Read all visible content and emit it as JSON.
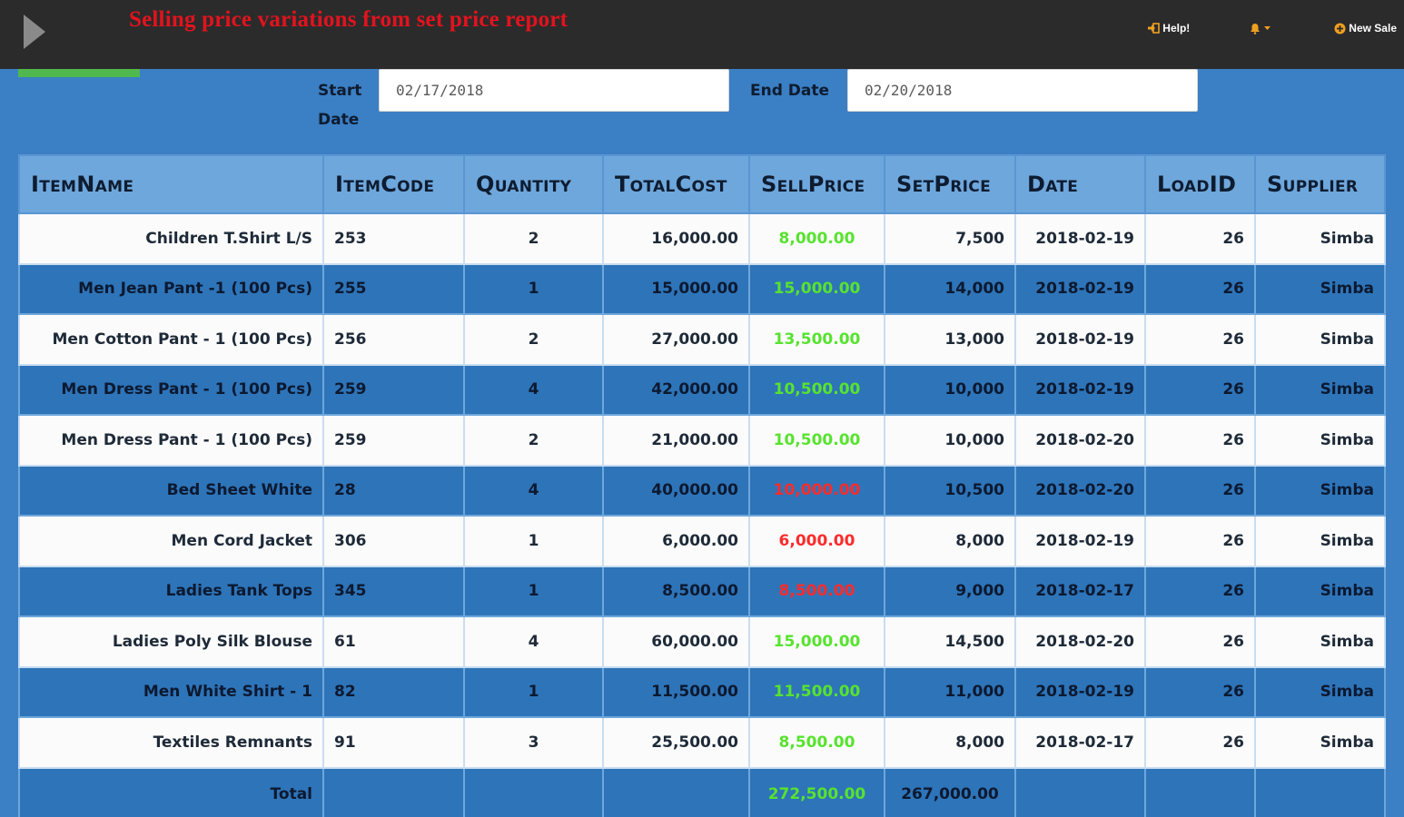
{
  "header": {
    "title": "Selling price variations from set price report",
    "help_label": "Help!",
    "new_sale_label": "New Sale"
  },
  "filters": {
    "start_label": "Start Date",
    "start_value": "02/17/2018",
    "end_label": "End Date",
    "end_value": "02/20/2018"
  },
  "table": {
    "columns": [
      "ItemName",
      "ItemCode",
      "Quantity",
      "TotalCost",
      "SellPrice",
      "SetPrice",
      "Date",
      "LoadID",
      "Supplier"
    ],
    "rows": [
      {
        "item_name": "Children T.Shirt L/S",
        "item_code": "253",
        "quantity": "2",
        "total_cost": "16,000.00",
        "sell_price": "8,000.00",
        "sell_status": "above",
        "set_price": "7,500",
        "date": "2018-02-19",
        "load_id": "26",
        "supplier": "Simba"
      },
      {
        "item_name": "Men Jean Pant -1 (100 Pcs)",
        "item_code": "255",
        "quantity": "1",
        "total_cost": "15,000.00",
        "sell_price": "15,000.00",
        "sell_status": "above",
        "set_price": "14,000",
        "date": "2018-02-19",
        "load_id": "26",
        "supplier": "Simba"
      },
      {
        "item_name": "Men Cotton Pant - 1 (100 Pcs)",
        "item_code": "256",
        "quantity": "2",
        "total_cost": "27,000.00",
        "sell_price": "13,500.00",
        "sell_status": "above",
        "set_price": "13,000",
        "date": "2018-02-19",
        "load_id": "26",
        "supplier": "Simba"
      },
      {
        "item_name": "Men Dress Pant - 1 (100 Pcs)",
        "item_code": "259",
        "quantity": "4",
        "total_cost": "42,000.00",
        "sell_price": "10,500.00",
        "sell_status": "above",
        "set_price": "10,000",
        "date": "2018-02-19",
        "load_id": "26",
        "supplier": "Simba"
      },
      {
        "item_name": "Men Dress Pant - 1 (100 Pcs)",
        "item_code": "259",
        "quantity": "2",
        "total_cost": "21,000.00",
        "sell_price": "10,500.00",
        "sell_status": "above",
        "set_price": "10,000",
        "date": "2018-02-20",
        "load_id": "26",
        "supplier": "Simba"
      },
      {
        "item_name": "Bed Sheet White",
        "item_code": "28",
        "quantity": "4",
        "total_cost": "40,000.00",
        "sell_price": "10,000.00",
        "sell_status": "below",
        "set_price": "10,500",
        "date": "2018-02-20",
        "load_id": "26",
        "supplier": "Simba"
      },
      {
        "item_name": "Men Cord Jacket",
        "item_code": "306",
        "quantity": "1",
        "total_cost": "6,000.00",
        "sell_price": "6,000.00",
        "sell_status": "below",
        "set_price": "8,000",
        "date": "2018-02-19",
        "load_id": "26",
        "supplier": "Simba"
      },
      {
        "item_name": "Ladies Tank Tops",
        "item_code": "345",
        "quantity": "1",
        "total_cost": "8,500.00",
        "sell_price": "8,500.00",
        "sell_status": "below",
        "set_price": "9,000",
        "date": "2018-02-17",
        "load_id": "26",
        "supplier": "Simba"
      },
      {
        "item_name": "Ladies Poly Silk Blouse",
        "item_code": "61",
        "quantity": "4",
        "total_cost": "60,000.00",
        "sell_price": "15,000.00",
        "sell_status": "above",
        "set_price": "14,500",
        "date": "2018-02-20",
        "load_id": "26",
        "supplier": "Simba"
      },
      {
        "item_name": "Men White Shirt - 1",
        "item_code": "82",
        "quantity": "1",
        "total_cost": "11,500.00",
        "sell_price": "11,500.00",
        "sell_status": "above",
        "set_price": "11,000",
        "date": "2018-02-19",
        "load_id": "26",
        "supplier": "Simba"
      },
      {
        "item_name": "Textiles Remnants",
        "item_code": "91",
        "quantity": "3",
        "total_cost": "25,500.00",
        "sell_price": "8,500.00",
        "sell_status": "above",
        "set_price": "8,000",
        "date": "2018-02-17",
        "load_id": "26",
        "supplier": "Simba"
      }
    ],
    "footer": {
      "label": "Total",
      "sell_price_total": "272,500.00",
      "set_price_total": "267,000.00"
    }
  },
  "icons": {
    "menu": "play-triangle-icon",
    "help": "sign-in-icon",
    "alerts": "bell-icon",
    "dropdown": "caret-down-icon",
    "new_sale": "circle-plus-icon"
  },
  "colors": {
    "topbar": "#2b2b2b",
    "title_red": "#e2131e",
    "page_blue": "#3b7fc4",
    "header_blue": "#6ea7dc",
    "row_blue": "#2e74b8",
    "sell_above_green": "#57e32f",
    "sell_below_red": "#ff2b2b",
    "accent_green": "#4fb94e",
    "icon_orange": "#f0a020"
  }
}
